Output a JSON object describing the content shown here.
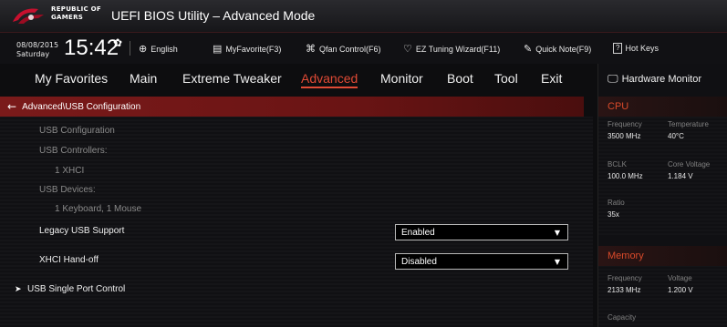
{
  "titlebar": {
    "brand_line1": "REPUBLIC OF",
    "brand_line2": "GAMERS",
    "title": "UEFI BIOS Utility – Advanced Mode"
  },
  "infobar": {
    "date": "08/08/2015",
    "day": "Saturday",
    "time": "15:42",
    "items": [
      {
        "icon": "globe-icon",
        "label": "English"
      },
      {
        "icon": "favorite-icon",
        "label": "MyFavorite(F3)"
      },
      {
        "icon": "fan-icon",
        "label": "Qfan Control(F6)"
      },
      {
        "icon": "bulb-icon",
        "label": "EZ Tuning Wizard(F11)"
      },
      {
        "icon": "note-icon",
        "label": "Quick Note(F9)"
      },
      {
        "icon": "help-icon",
        "label": "Hot Keys",
        "box": "?"
      }
    ]
  },
  "menu": {
    "items": [
      "My Favorites",
      "Main",
      "Extreme Tweaker",
      "Advanced",
      "Monitor",
      "Boot",
      "Tool",
      "Exit"
    ],
    "active": "Advanced"
  },
  "breadcrumb": "Advanced\\USB Configuration",
  "content": {
    "usb_config": "USB Configuration",
    "usb_controllers": "USB Controllers:",
    "controllers_value": "1 XHCI",
    "usb_devices": "USB Devices:",
    "devices_value": "1 Keyboard, 1 Mouse",
    "legacy_label": "Legacy USB Support",
    "legacy_value": "Enabled",
    "xhci_label": "XHCI Hand-off",
    "xhci_value": "Disabled",
    "single_port": "USB Single Port Control"
  },
  "hwmon": {
    "title": "Hardware Monitor",
    "cpu": {
      "section": "CPU",
      "frequency_label": "Frequency",
      "frequency": "3500 MHz",
      "temperature_label": "Temperature",
      "temperature": "40°C",
      "bclk_label": "BCLK",
      "bclk": "100.0 MHz",
      "core_voltage_label": "Core Voltage",
      "core_voltage": "1.184 V",
      "ratio_label": "Ratio",
      "ratio": "35x"
    },
    "memory": {
      "section": "Memory",
      "frequency_label": "Frequency",
      "frequency": "2133 MHz",
      "voltage_label": "Voltage",
      "voltage": "1.200 V",
      "capacity_label": "Capacity"
    }
  },
  "colors": {
    "accent": "#e04a35",
    "breadcrumb_bg": "#7a1a1a",
    "section_label": "#d94a2a"
  }
}
